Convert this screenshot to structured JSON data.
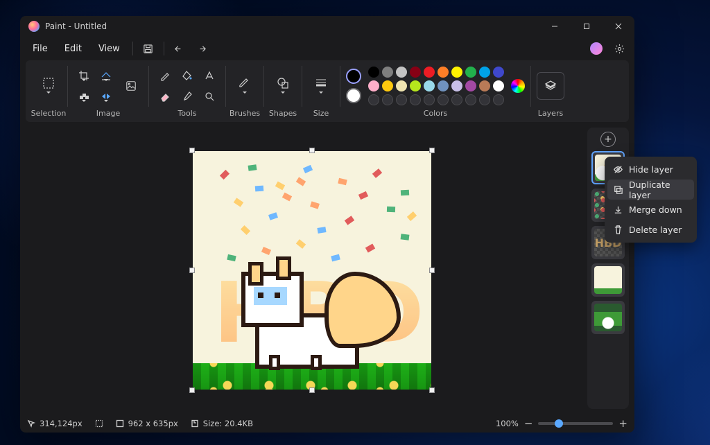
{
  "window": {
    "title": "Paint - Untitled"
  },
  "menubar": {
    "file": "File",
    "edit": "Edit",
    "view": "View"
  },
  "ribbon": {
    "selection_label": "Selection",
    "image_label": "Image",
    "tools_label": "Tools",
    "brushes_label": "Brushes",
    "shapes_label": "Shapes",
    "size_label": "Size",
    "colors_label": "Colors",
    "layers_label": "Layers"
  },
  "colors": {
    "primary": "#000000",
    "secondary": "#ffffff",
    "row1": [
      "#000000",
      "#7f7f7f",
      "#c3c3c3",
      "#880015",
      "#ed1c24",
      "#ff7f27",
      "#fff200",
      "#22b14c",
      "#00a2e8",
      "#3f48cc"
    ],
    "row2": [
      "#ffaec9",
      "#ffc90e",
      "#efe4b0",
      "#b5e61d",
      "#99d9ea",
      "#7092be",
      "#c8bfe7",
      "#a349a4",
      "#b97a57",
      "#ffffff"
    ]
  },
  "context_menu": {
    "hide": "Hide layer",
    "duplicate": "Duplicate layer",
    "merge": "Merge down",
    "delete": "Delete layer"
  },
  "layers": {
    "thumb3_text": "HBD"
  },
  "statusbar": {
    "cursor": "314,124px",
    "canvas_size": "962  x  635px",
    "file_size": "Size: 20.4KB",
    "zoom": "100%"
  },
  "canvas_art": {
    "text": "HBD"
  }
}
